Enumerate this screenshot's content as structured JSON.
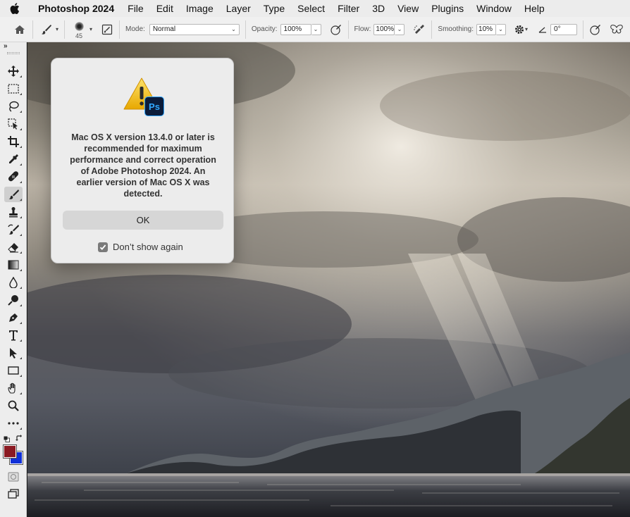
{
  "menubar": {
    "app_name": "Photoshop 2024",
    "items": [
      "File",
      "Edit",
      "Image",
      "Layer",
      "Type",
      "Select",
      "Filter",
      "3D",
      "View",
      "Plugins",
      "Window",
      "Help"
    ]
  },
  "options_bar": {
    "brush_size": "45",
    "mode_label": "Mode:",
    "mode_value": "Normal",
    "opacity_label": "Opacity:",
    "opacity_value": "100%",
    "flow_label": "Flow:",
    "flow_value": "100%",
    "smoothing_label": "Smoothing:",
    "smoothing_value": "10%",
    "angle_value": "0°"
  },
  "toolbar": {
    "active_tool": "brush-tool",
    "foreground_color": "#8b1a22",
    "background_color": "#1030d8"
  },
  "dialog": {
    "message": "Mac OS X version 13.4.0 or later is recommended for maximum performance and correct operation of Adobe Photoshop 2024. An earlier version of Mac OS X was detected.",
    "ok_label": "OK",
    "checkbox_label": "Don’t show again",
    "checkbox_checked": true,
    "badge_text": "Ps"
  },
  "colors": {
    "ps_badge": "#0b1c3a",
    "ps_text": "#31a8ff",
    "warning_yellow": "#f5c400"
  }
}
